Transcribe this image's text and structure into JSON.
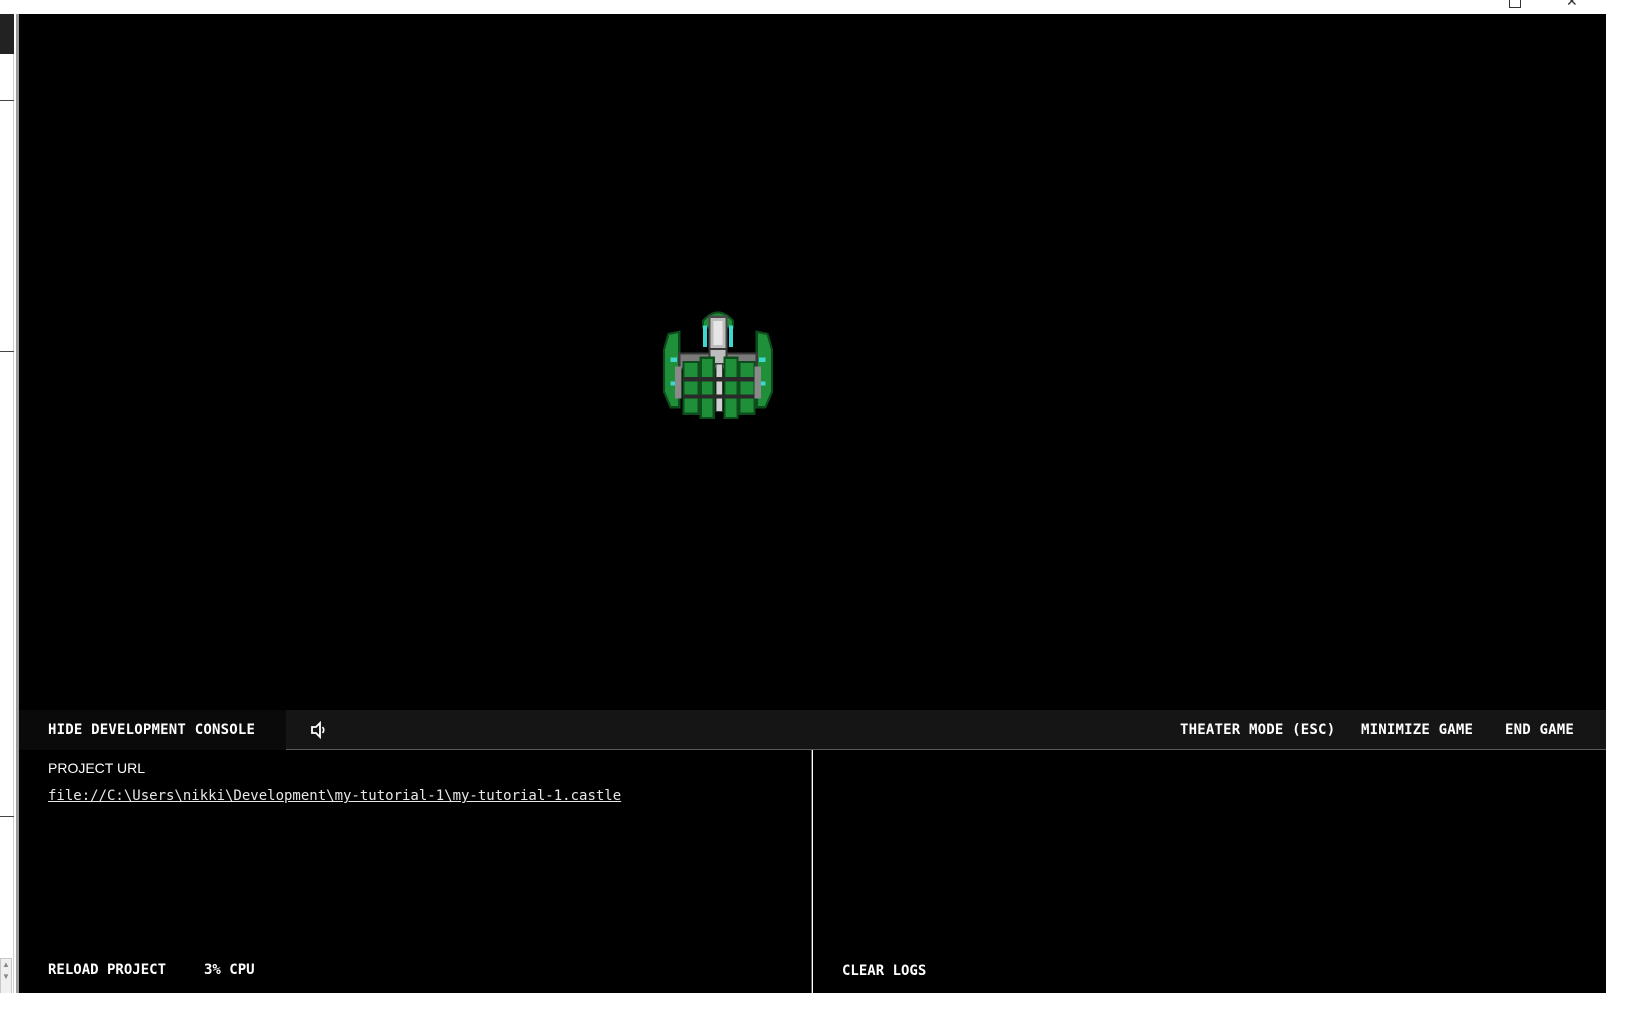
{
  "window": {
    "maximize_icon": "maximize-icon",
    "close_glyph": "✕"
  },
  "game": {
    "sprite": "green-spaceship"
  },
  "console_bar": {
    "hide_console": "HIDE DEVELOPMENT CONSOLE",
    "mute_icon": "speaker-icon",
    "theater_mode": "THEATER MODE (ESC)",
    "minimize_game": "MINIMIZE GAME",
    "end_game": "END GAME"
  },
  "left_panel": {
    "project_url_label": "PROJECT URL",
    "project_url": "file://C:\\Users\\nikki\\Development\\my-tutorial-1\\my-tutorial-1.castle",
    "reload_project": "RELOAD PROJECT",
    "cpu": "3% CPU"
  },
  "right_panel": {
    "clear_logs": "CLEAR LOGS"
  },
  "colors": {
    "background": "#000000",
    "bar": "#151515",
    "text": "#ffffff",
    "ship_green": "#1f8f3a",
    "ship_cyan": "#3fd6d0"
  }
}
